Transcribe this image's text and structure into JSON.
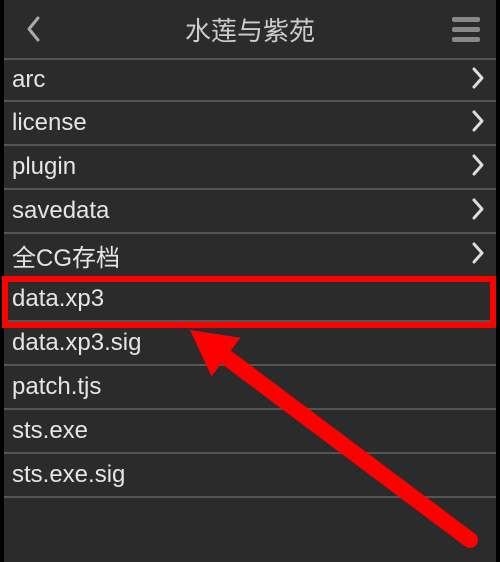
{
  "header": {
    "title": "水莲与紫苑"
  },
  "items": [
    {
      "label": "arc",
      "chevron": true,
      "highlight": false
    },
    {
      "label": "license",
      "chevron": true,
      "highlight": false
    },
    {
      "label": "plugin",
      "chevron": true,
      "highlight": false
    },
    {
      "label": "savedata",
      "chevron": true,
      "highlight": false
    },
    {
      "label": "全CG存档",
      "chevron": true,
      "highlight": false
    },
    {
      "label": "data.xp3",
      "chevron": false,
      "highlight": true
    },
    {
      "label": "data.xp3.sig",
      "chevron": false,
      "highlight": false
    },
    {
      "label": "patch.tjs",
      "chevron": false,
      "highlight": false
    },
    {
      "label": "sts.exe",
      "chevron": false,
      "highlight": false
    },
    {
      "label": "sts.exe.sig",
      "chevron": false,
      "highlight": false
    }
  ],
  "annotation": {
    "highlight_color": "#ff0000"
  }
}
